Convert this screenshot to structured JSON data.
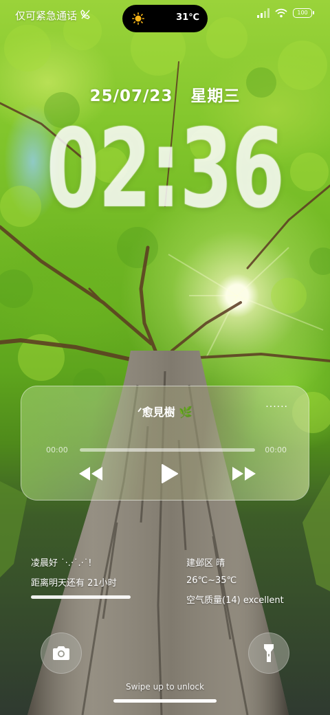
{
  "status_bar": {
    "carrier": "仅可紧急通话",
    "weather_temp": "31℃",
    "battery_level": "100"
  },
  "lock_clock": {
    "date": "25/07/23",
    "weekday": "星期三",
    "time": "02:36"
  },
  "music_player": {
    "title": "ᐟ愈見樹 🌿",
    "more_label": "······",
    "elapsed": "00:00",
    "total": "00:00",
    "progress_fraction": 0
  },
  "day_widget": {
    "greeting": "凌晨好 ˙·.·˙.·˙!",
    "countdown": "距离明天还有 21小时",
    "day_progress_fraction": 1
  },
  "weather_widget": {
    "location_condition": "建邺区 晴",
    "temp_range": "26℃~35℃",
    "air_quality": "空气质量(14) excellent"
  },
  "unlock_hint": "Swipe up to unlock",
  "icons": [
    "no-signal-call-icon",
    "sun-icon",
    "cellular-signal-icon",
    "wifi-icon",
    "battery-icon",
    "prev-icon",
    "play-icon",
    "next-icon",
    "camera-icon",
    "flashlight-icon"
  ],
  "colors": {
    "island": "#000000",
    "text": "#ffffff",
    "canopy": "#7cc52c",
    "sun": "#fffbe0"
  }
}
